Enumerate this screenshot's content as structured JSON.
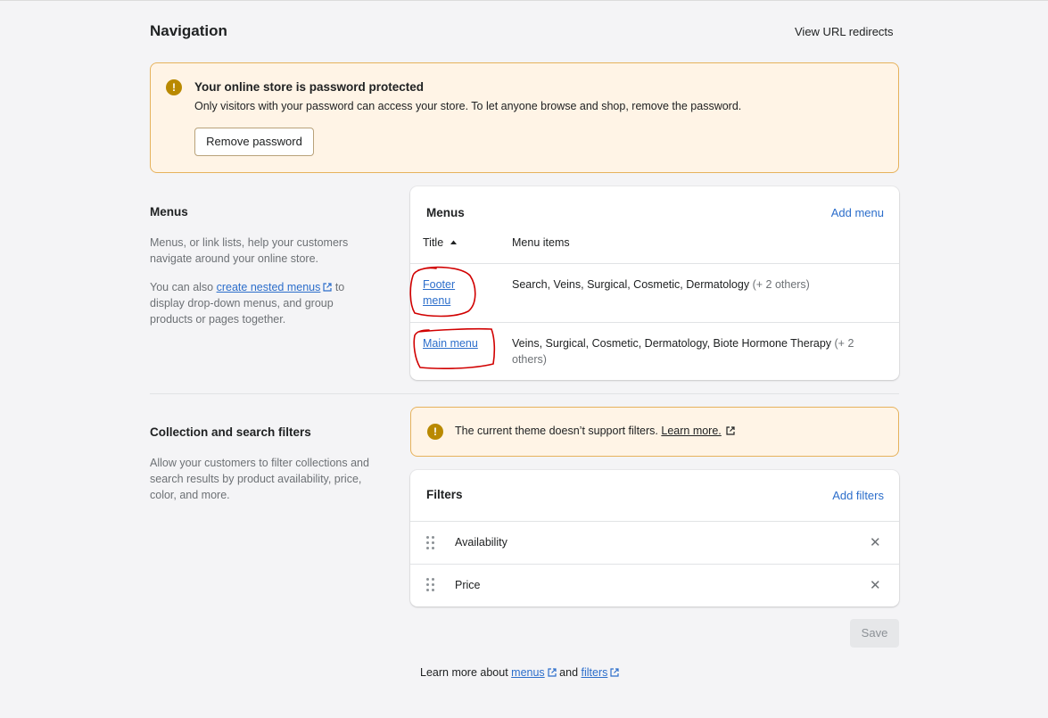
{
  "page": {
    "title": "Navigation",
    "view_redirects_label": "View URL redirects"
  },
  "password_banner": {
    "title": "Your online store is password protected",
    "text": "Only visitors with your password can access your store. To let anyone browse and shop, remove the password.",
    "button_label": "Remove password"
  },
  "menus_section": {
    "heading": "Menus",
    "desc1": "Menus, or link lists, help your customers navigate around your online store.",
    "desc2_prefix": "You can also ",
    "desc2_link": "create nested menus",
    "desc2_suffix": " to display drop-down menus, and group products or pages together."
  },
  "menus_card": {
    "title": "Menus",
    "add_label": "Add menu",
    "col_title": "Title",
    "col_items": "Menu items",
    "sort_icon": "sort-ascending-icon",
    "rows": [
      {
        "name": "Footer menu",
        "items": "Search, Veins, Surgical, Cosmetic, Dermatology",
        "others": "(+ 2 others)"
      },
      {
        "name": "Main menu",
        "items": "Veins, Surgical, Cosmetic, Dermatology, Biote Hormone Therapy",
        "others": "(+ 2 others)"
      }
    ]
  },
  "filters_section": {
    "heading": "Collection and search filters",
    "desc": "Allow your customers to filter collections and search results by product availability, price, color, and more."
  },
  "filters_banner": {
    "text": "The current theme doesn’t support filters. ",
    "link": "Learn more."
  },
  "filters_card": {
    "title": "Filters",
    "add_label": "Add filters",
    "items": [
      "Availability",
      "Price"
    ]
  },
  "save_label": "Save",
  "footer": {
    "prefix": "Learn more about ",
    "menus_link": "menus",
    "and": " and ",
    "filters_link": "filters"
  },
  "colors": {
    "accent": "#2c6ecb",
    "warning_bg": "#fff4e6",
    "warning_border": "#e6b25c",
    "warning_icon": "#b98900",
    "annotation": "#d10000"
  }
}
